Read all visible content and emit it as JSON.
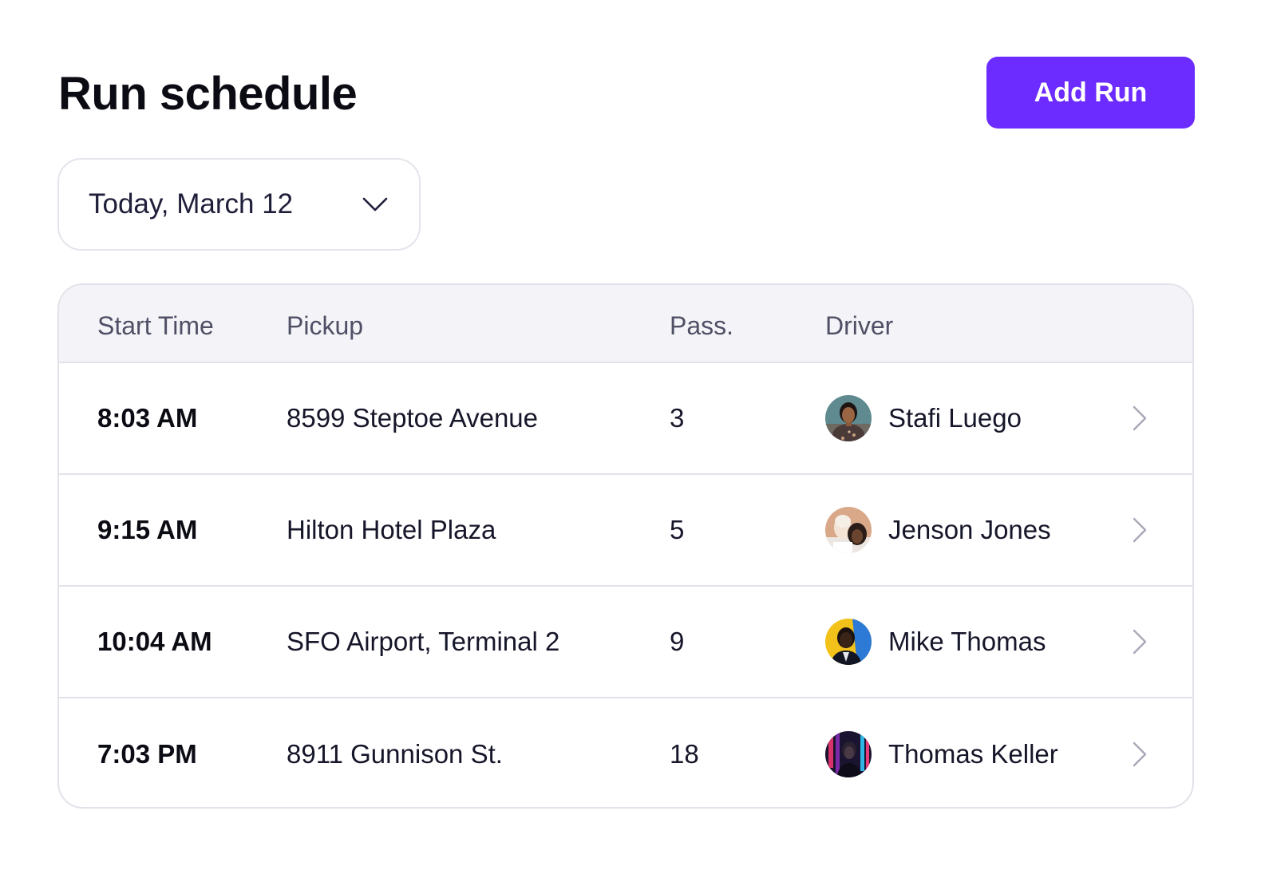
{
  "header": {
    "title": "Run schedule",
    "add_button_label": "Add Run"
  },
  "date_filter": {
    "selected": "Today, March 12",
    "icon": "chevron-down-icon"
  },
  "table": {
    "columns": [
      "Start Time",
      "Pickup",
      "Pass.",
      "Driver"
    ],
    "rows": [
      {
        "start_time": "8:03 AM",
        "pickup": "8599 Steptoe Avenue",
        "passengers": "3",
        "driver": "Stafi Luego"
      },
      {
        "start_time": "9:15 AM",
        "pickup": "Hilton Hotel Plaza",
        "passengers": "5",
        "driver": "Jenson Jones"
      },
      {
        "start_time": "10:04 AM",
        "pickup": "SFO Airport, Terminal 2",
        "passengers": "9",
        "driver": "Mike Thomas"
      },
      {
        "start_time": "7:03 PM",
        "pickup": "8911 Gunnison St.",
        "passengers": "18",
        "driver": "Thomas Keller"
      }
    ],
    "row_action_icon": "chevron-right-icon"
  },
  "colors": {
    "accent": "#6c2bff",
    "header_bg": "#f4f4f8",
    "border": "#e2e2ea"
  }
}
